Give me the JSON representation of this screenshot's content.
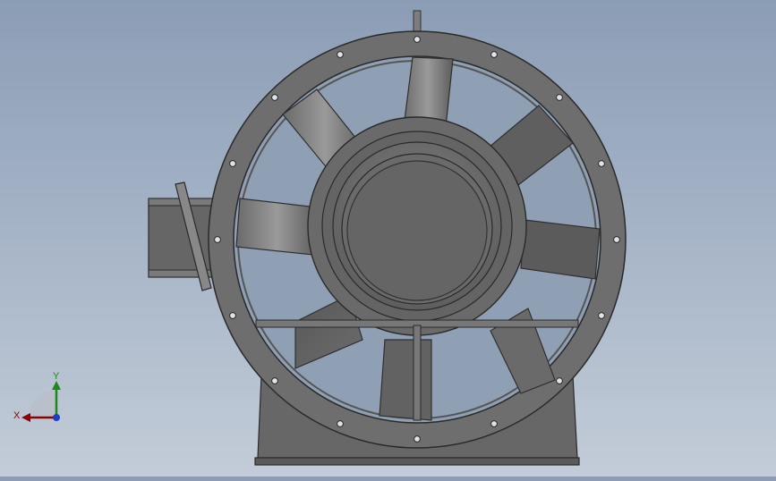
{
  "viewport": {
    "model": "axial-fan",
    "view_orientation": "front",
    "background_colors": [
      "#8b9db5",
      "#c3ccd8"
    ],
    "part_color": "#6e6e6e"
  },
  "triad": {
    "x_label": "X",
    "y_label": "Y",
    "x_color": "#8b0000",
    "y_color": "#1a8a1a",
    "z_color": "#1f3cc4"
  }
}
